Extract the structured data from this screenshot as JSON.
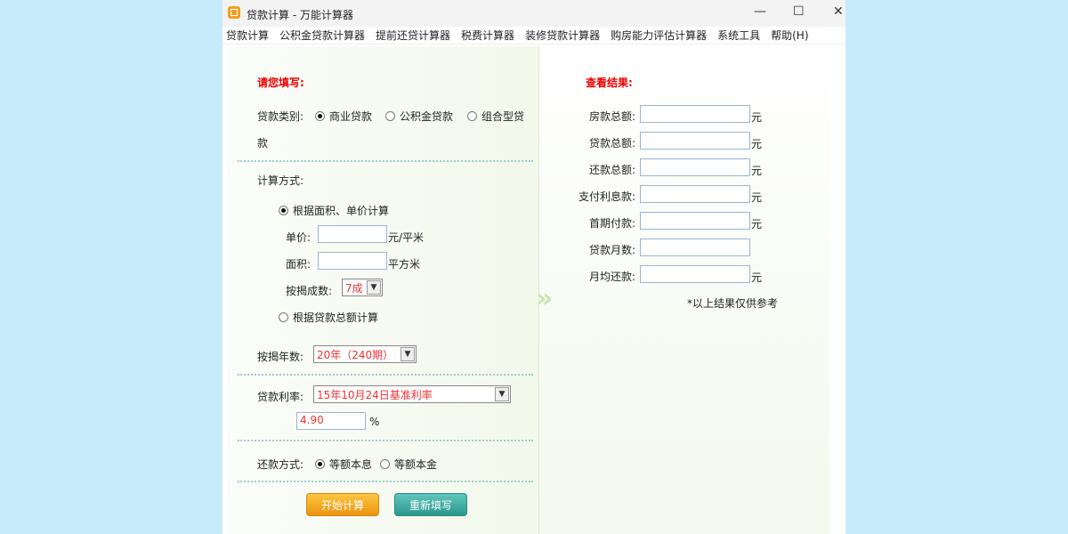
{
  "window": {
    "title": "贷款计算 - 万能计算器",
    "min": "—",
    "max": "☐",
    "close": "✕"
  },
  "menu": [
    "贷款计算",
    "公积金贷款计算器",
    "提前还贷计算器",
    "税费计算器",
    "装修贷款计算器",
    "购房能力评估计算器",
    "系统工具",
    "帮助(H)"
  ],
  "form": {
    "heading": "请您填写:",
    "loan_type_label": "贷款类别:",
    "loan_types": [
      "商业贷款",
      "公积金贷款",
      "组合型贷",
      "款"
    ],
    "calc_method_label": "计算方式:",
    "method_area": "根据面积、单价计算",
    "unit_price_label": "单价:",
    "unit_price_unit": "元/平米",
    "unit_price_value": "",
    "area_label": "面积:",
    "area_unit": "平方米",
    "area_value": "",
    "ratio_label": "按揭成数:",
    "ratio_value": "7成",
    "method_total": "根据贷款总额计算",
    "years_label": "按揭年数:",
    "years_value": "20年（240期）",
    "rate_label": "贷款利率:",
    "rate_select": "15年10月24日基准利率",
    "rate_value": "4.90",
    "rate_unit": "%",
    "repay_label": "还款方式:",
    "repay_options": [
      "等额本息",
      "等额本金"
    ],
    "calc_button": "开始计算",
    "reset_button": "重新填写"
  },
  "result": {
    "heading": "查看结果:",
    "rows": [
      {
        "label": "房款总额:",
        "unit": "元"
      },
      {
        "label": "贷款总额:",
        "unit": "元"
      },
      {
        "label": "还款总额:",
        "unit": "元"
      },
      {
        "label": "支付利息款:",
        "unit": "元"
      },
      {
        "label": "首期付款:",
        "unit": "元"
      },
      {
        "label": "贷款月数:",
        "unit": ""
      },
      {
        "label": "月均还款:",
        "unit": "元"
      }
    ],
    "note": "*以上结果仅供参考"
  }
}
